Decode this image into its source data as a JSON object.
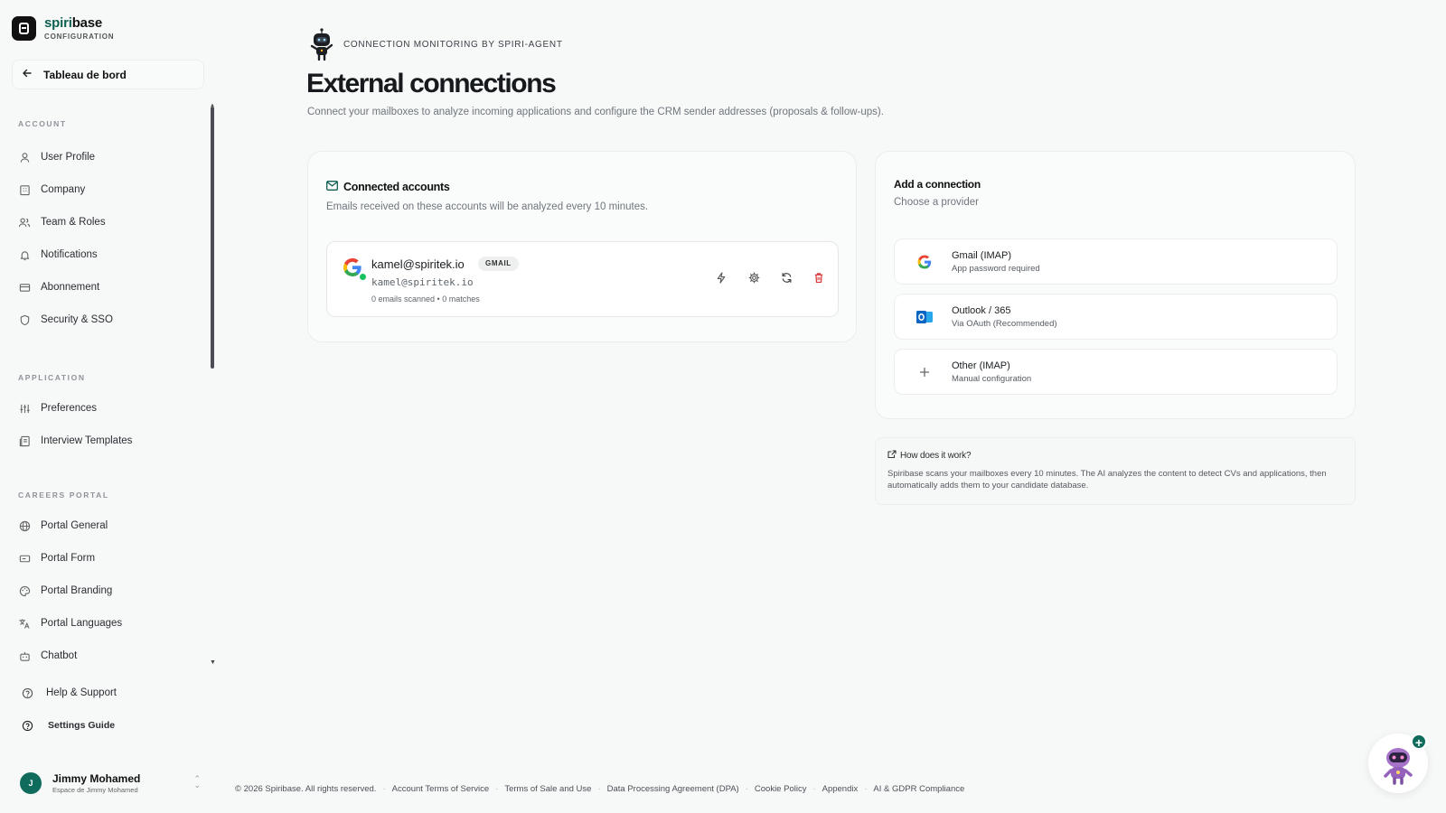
{
  "brand": {
    "name_a": "spiri",
    "name_b": "base",
    "sub": "CONFIGURATION"
  },
  "back": {
    "label": "Tableau de bord"
  },
  "sidebar": {
    "sections": [
      {
        "title": "ACCOUNT",
        "items": [
          {
            "label": "User Profile",
            "icon": "user-icon"
          },
          {
            "label": "Company",
            "icon": "building-icon"
          },
          {
            "label": "Team & Roles",
            "icon": "users-icon"
          },
          {
            "label": "Notifications",
            "icon": "bell-icon"
          },
          {
            "label": "Abonnement",
            "icon": "credit-card-icon"
          },
          {
            "label": "Security & SSO",
            "icon": "shield-icon"
          }
        ]
      },
      {
        "title": "APPLICATION",
        "items": [
          {
            "label": "Preferences",
            "icon": "sliders-icon"
          },
          {
            "label": "Interview Templates",
            "icon": "template-icon"
          }
        ]
      },
      {
        "title": "CAREERS PORTAL",
        "items": [
          {
            "label": "Portal General",
            "icon": "globe-icon"
          },
          {
            "label": "Portal Form",
            "icon": "form-icon"
          },
          {
            "label": "Portal Branding",
            "icon": "palette-icon"
          },
          {
            "label": "Portal Languages",
            "icon": "translate-icon"
          },
          {
            "label": "Chatbot",
            "icon": "bot-icon"
          }
        ]
      }
    ],
    "bottom": [
      {
        "label": "Help & Support",
        "icon": "help-circle-icon"
      },
      {
        "label": "Settings Guide",
        "icon": "help-circle-icon"
      }
    ]
  },
  "user": {
    "initial": "J",
    "name": "Jimmy Mohamed",
    "space": "Espace de Jimmy Mohamed"
  },
  "header": {
    "eyebrow": "CONNECTION MONITORING BY SPIRI-AGENT",
    "title": "External connections",
    "subtitle": "Connect your mailboxes to analyze incoming applications and configure the CRM sender addresses (proposals & follow-ups)."
  },
  "accounts": {
    "title": "Connected accounts",
    "subtitle": "Emails received on these accounts will be analyzed every 10 minutes.",
    "items": [
      {
        "email": "kamel@spiritek.io",
        "badge": "GMAIL",
        "address": "kamel@spiritek.io",
        "meta": "0 emails scanned • 0 matches",
        "status": "connected"
      }
    ]
  },
  "add_connection": {
    "title": "Add a connection",
    "subtitle": "Choose a provider",
    "providers": [
      {
        "name": "Gmail (IMAP)",
        "desc": "App password required",
        "icon": "google-icon"
      },
      {
        "name": "Outlook / 365",
        "desc": "Via OAuth (Recommended)",
        "icon": "outlook-icon"
      },
      {
        "name": "Other (IMAP)",
        "desc": "Manual configuration",
        "icon": "plus-icon"
      }
    ]
  },
  "how": {
    "title": "How does it work?",
    "text": "Spiribase scans your mailboxes every 10 minutes. The AI analyzes the content to detect CVs and applications, then automatically adds them to your candidate database."
  },
  "footer": {
    "copyright": "© 2026 Spiribase. All rights reserved.",
    "links": [
      "Account Terms of Service",
      "Terms of Sale and Use",
      "Data Processing Agreement (DPA)",
      "Cookie Policy",
      "Appendix",
      "AI & GDPR Compliance"
    ]
  },
  "colors": {
    "brand_green": "#0f5e51",
    "online": "#16c25f",
    "danger": "#d93636"
  }
}
